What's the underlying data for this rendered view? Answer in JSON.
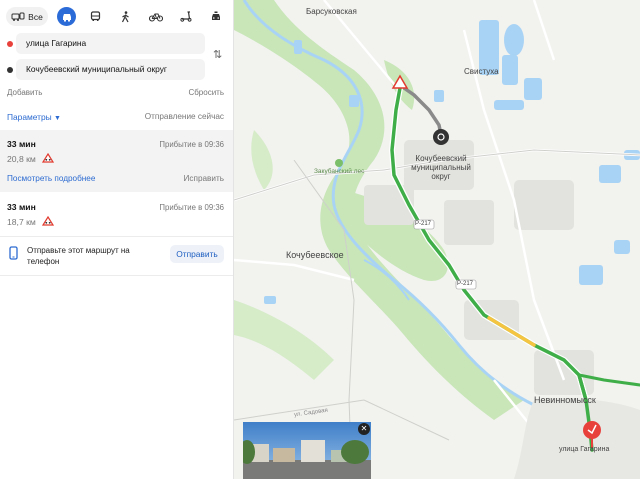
{
  "modes": {
    "all_label": "Все",
    "icons": [
      "car-icon",
      "bus-icon",
      "pedestrian-icon",
      "bicycle-icon",
      "scooter-icon",
      "taxi-icon"
    ]
  },
  "points": {
    "from": "улица Гагарина",
    "to": "Кочубеевский муниципальный округ",
    "add": "Добавить",
    "reset": "Сбросить"
  },
  "params": {
    "label": "Параметры",
    "departure": "Отправление сейчас"
  },
  "routes": [
    {
      "time": "33 мин",
      "distance": "20,8 км",
      "arrival": "Прибытие в 09:36",
      "details": "Посмотреть подробнее",
      "fix": "Исправить"
    },
    {
      "time": "33 мин",
      "distance": "18,7 км",
      "arrival": "Прибытие в 09:36"
    }
  ],
  "send": {
    "text": "Отправьте этот маршрут на телефон",
    "button": "Отправить"
  },
  "map": {
    "labels": {
      "barsukovskaya": "Барсуковская",
      "svistukha": "Свистуха",
      "kochubeevsky_okrug": "Кочубеевский муниципальный округ",
      "zakubansky_les": "Закубанский лес",
      "kochubeevskoe": "Кочубеевское",
      "nevinnomyssk": "Невинномысск",
      "road_r217_a": "Р-217",
      "road_r217_b": "Р-217",
      "street": "улица Гагарина",
      "street_partial": "ул. Садовая"
    },
    "colors": {
      "route": "#3fae49",
      "water": "#a9d3f5",
      "forest": "#c8e6b8",
      "land": "#f2f2ef"
    }
  }
}
